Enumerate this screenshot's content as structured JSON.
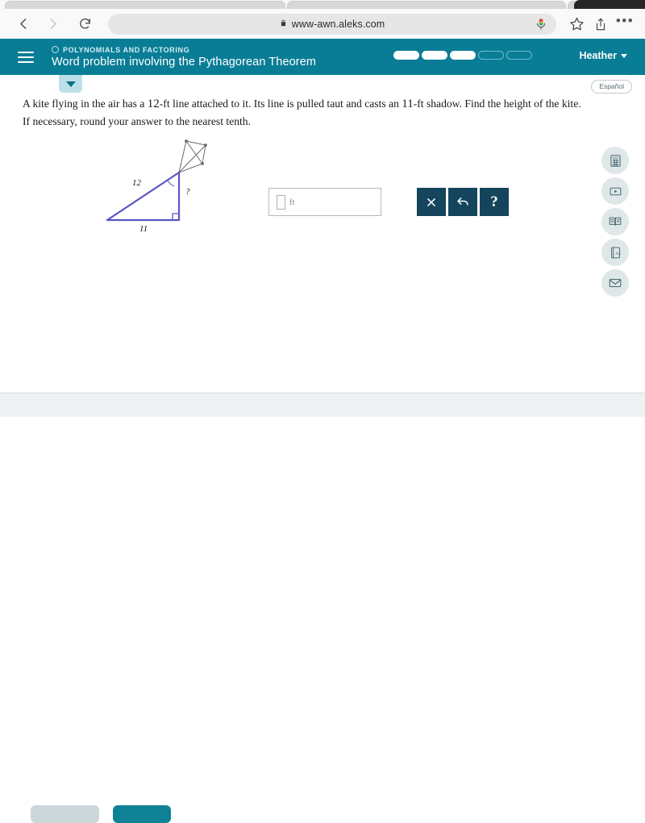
{
  "browser": {
    "url": "www-awn.aleks.com",
    "back_label": "Back",
    "forward_label": "Forward",
    "reload_label": "Reload",
    "bookmark_label": "Bookmark",
    "share_label": "Share",
    "menu_label": "More",
    "mic_label": "Voice search",
    "tabs": [
      "",
      "",
      "",
      ""
    ]
  },
  "header": {
    "menu_label": "Menu",
    "topic": "POLYNOMIALS AND FACTORING",
    "title": "Word problem involving the Pythagorean Theorem",
    "user": "Heather",
    "progress": {
      "total": 5,
      "filled": 3,
      "segments": [
        "filled",
        "filled",
        "filled",
        "empty",
        "empty"
      ]
    }
  },
  "subbar": {
    "expand_label": "Expand",
    "espanol_label": "Español"
  },
  "question": {
    "part1": "A kite flying in the air has a ",
    "line_length": "12",
    "part2": "-ft line attached to it. Its line is pulled taut and casts an ",
    "shadow_length": "11",
    "part3": "-ft shadow. Find the height of the kite. If necessary, round your answer to the nearest tenth."
  },
  "figure": {
    "hypotenuse_label": "12",
    "base_label": "11",
    "height_label": "?",
    "angle_label": "",
    "line_color": "#5b56c8",
    "kite_color": "#6a6a6a"
  },
  "answer": {
    "value": "",
    "placeholder": "",
    "unit": "ft",
    "clear_label": "×",
    "undo_label": "↰",
    "help_label": "?"
  },
  "rail": {
    "items": [
      {
        "name": "calculator-icon",
        "label": "Calculator"
      },
      {
        "name": "video-icon",
        "label": "Video"
      },
      {
        "name": "ebook-icon",
        "label": "eBook"
      },
      {
        "name": "glossary-icon",
        "label": "Glossary"
      },
      {
        "name": "message-icon",
        "label": "Message"
      }
    ]
  },
  "bottom": {
    "secondary_label": "",
    "primary_label": ""
  },
  "colors": {
    "teal": "#0a7d96",
    "dark_navy": "#14455c",
    "light_teal": "#bde0e8",
    "rail_bg": "#dfe7e8"
  }
}
